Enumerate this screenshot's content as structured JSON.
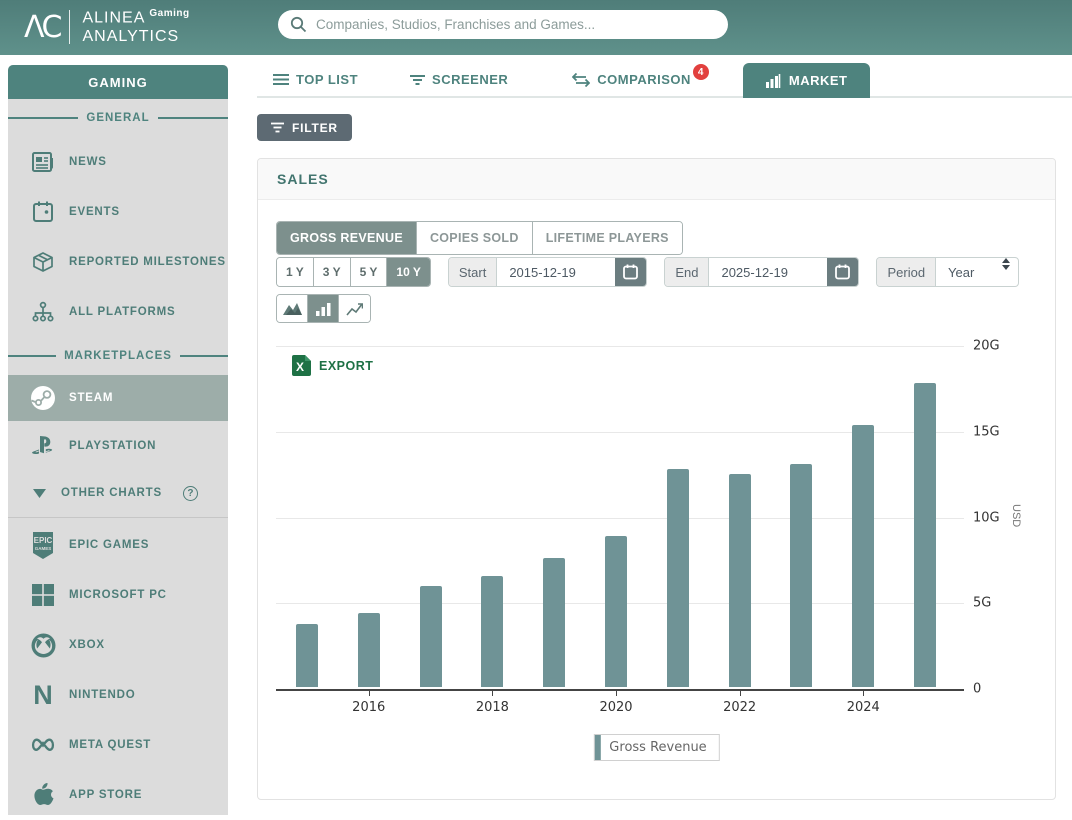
{
  "header": {
    "logo_glyph": "ΛC",
    "brand_name": "ALINEA",
    "brand_sup": "Gaming",
    "brand_sub": "ANALYTICS",
    "search_placeholder": "Companies, Studios, Franchises and Games..."
  },
  "sidebar": {
    "title": "GAMING",
    "section_general": "GENERAL",
    "section_marketplaces": "MARKETPLACES",
    "items": [
      {
        "label": "NEWS"
      },
      {
        "label": "EVENTS"
      },
      {
        "label": "REPORTED MILESTONES"
      },
      {
        "label": "ALL PLATFORMS"
      },
      {
        "label": "STEAM",
        "active": true
      },
      {
        "label": "PLAYSTATION"
      },
      {
        "label": "OTHER CHARTS",
        "help": "?"
      },
      {
        "label": "EPIC GAMES"
      },
      {
        "label": "MICROSOFT PC"
      },
      {
        "label": "XBOX"
      },
      {
        "label": "NINTENDO"
      },
      {
        "label": "META QUEST"
      },
      {
        "label": "APP STORE"
      }
    ]
  },
  "tabs": [
    {
      "label": "TOP LIST"
    },
    {
      "label": "SCREENER"
    },
    {
      "label": "COMPARISON",
      "badge": "4"
    },
    {
      "label": "MARKET",
      "active": true
    }
  ],
  "toolbar": {
    "filter_label": "FILTER"
  },
  "sales": {
    "title": "SALES",
    "metric_tabs": [
      {
        "label": "GROSS REVENUE",
        "active": true
      },
      {
        "label": "COPIES SOLD"
      },
      {
        "label": "LIFETIME PLAYERS"
      }
    ],
    "ranges": [
      {
        "label": "1 Y"
      },
      {
        "label": "3 Y"
      },
      {
        "label": "5 Y"
      },
      {
        "label": "10 Y",
        "active": true
      }
    ],
    "start_label": "Start",
    "start_value": "2015-12-19",
    "end_label": "End",
    "end_value": "2025-12-19",
    "period_label": "Period",
    "period_value": "Year",
    "export_label": "EXPORT"
  },
  "chart_data": {
    "type": "bar",
    "title": "Gross Revenue on Steam by year",
    "categories": [
      2015,
      2016,
      2017,
      2018,
      2019,
      2020,
      2021,
      2022,
      2023,
      2024,
      2025
    ],
    "values": [
      3.7,
      4.3,
      5.9,
      6.5,
      7.5,
      8.8,
      12.7,
      12.4,
      13.0,
      15.3,
      17.7
    ],
    "unit": "G",
    "ylabel": "USD",
    "ylim": [
      0,
      20
    ],
    "yticks": [
      "0",
      "5G",
      "10G",
      "15G",
      "20G"
    ],
    "xticks": [
      "2016",
      "2018",
      "2020",
      "2022",
      "2024"
    ],
    "legend": [
      "Gross Revenue"
    ],
    "legend_position": "bottom",
    "grid": true,
    "bar_color": "#6f9396"
  },
  "colors": {
    "teal": "#4e837e",
    "active_muted": "#7d908d",
    "steam_active_bg": "#9dada9",
    "bar": "#6f9396",
    "filter_button": "#5d6a73",
    "badge_red": "#e2403e",
    "excel_green": "#1e7145"
  }
}
